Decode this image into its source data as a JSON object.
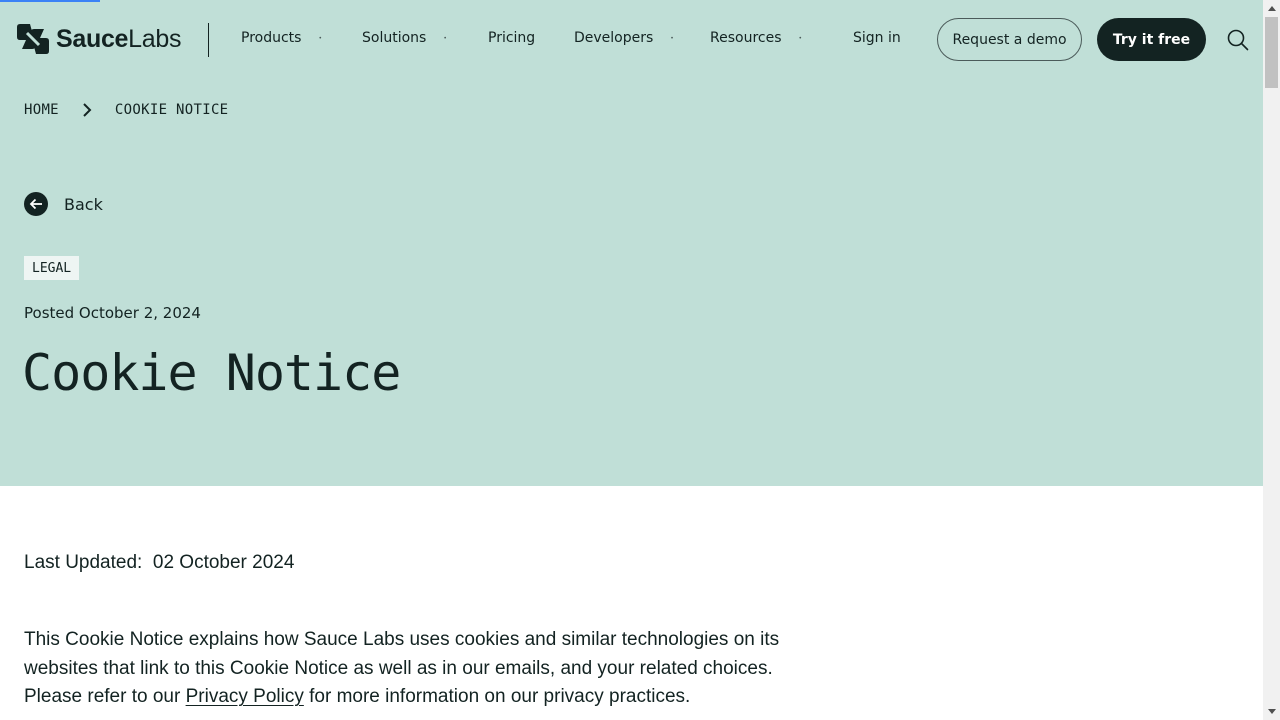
{
  "brand": {
    "name_part1": "Sauce",
    "name_part2": "Labs",
    "accent": "#c0dfd7",
    "dark": "#132322"
  },
  "nav": {
    "items": [
      {
        "label": "Products",
        "has_dropdown": true
      },
      {
        "label": "Solutions",
        "has_dropdown": true
      },
      {
        "label": "Pricing",
        "has_dropdown": false
      },
      {
        "label": "Developers",
        "has_dropdown": true
      },
      {
        "label": "Resources",
        "has_dropdown": true
      }
    ],
    "dropdown_glyph": "•",
    "sign_in": "Sign in",
    "request_demo": "Request a demo",
    "try_free": "Try it free",
    "search_icon": "search-icon"
  },
  "breadcrumb": {
    "home": "HOME",
    "current": "COOKIE NOTICE"
  },
  "hero": {
    "back_label": "Back",
    "tag": "LEGAL",
    "posted": "Posted October 2, 2024",
    "title": "Cookie Notice"
  },
  "content": {
    "last_updated_label": "Last Updated:",
    "last_updated_value": "02 October 2024",
    "intro_part1": "This Cookie Notice explains how Sauce Labs uses cookies and similar technologies on its websites that link to this Cookie Notice as well as in our emails, and your related choices. Please refer to our ",
    "intro_link": "Privacy Policy",
    "intro_part2": " for more information on our privacy practices."
  }
}
